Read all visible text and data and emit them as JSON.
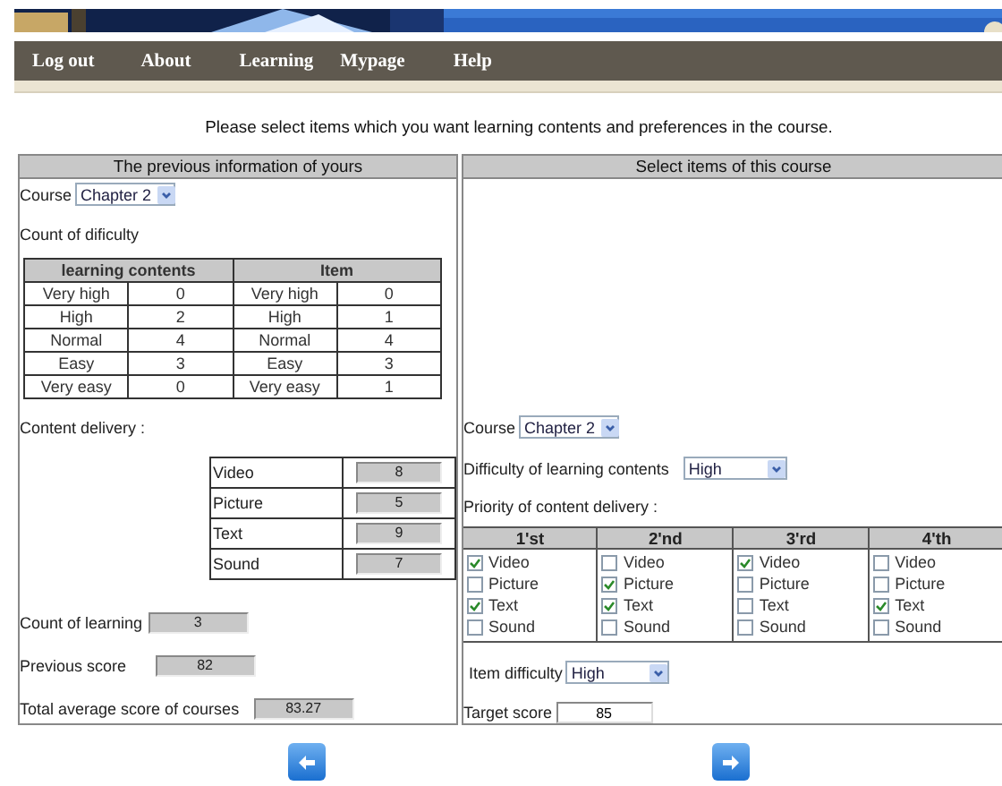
{
  "nav": {
    "items": [
      "Log out",
      "About",
      "Learning",
      "Mypage",
      "Help"
    ]
  },
  "instruction": "Please select items which you want learning contents and preferences in the course.",
  "previous": {
    "title": "The previous information of yours",
    "course": {
      "label": "Course",
      "value": "Chapter 2"
    },
    "difficulty_title": "Count of dificulty",
    "difficulty_table": {
      "groups": [
        "learning contents",
        "Item"
      ],
      "rows": [
        [
          "Very high",
          "0",
          "Very high",
          "0"
        ],
        [
          "High",
          "2",
          "High",
          "1"
        ],
        [
          "Normal",
          "4",
          "Normal",
          "4"
        ],
        [
          "Easy",
          "3",
          "Easy",
          "3"
        ],
        [
          "Very easy",
          "0",
          "Very easy",
          "1"
        ]
      ]
    },
    "delivery_title": "Content delivery :",
    "delivery": [
      {
        "name": "Video",
        "value": "8"
      },
      {
        "name": "Picture",
        "value": "5"
      },
      {
        "name": "Text",
        "value": "9"
      },
      {
        "name": "Sound",
        "value": "7"
      }
    ],
    "fields": [
      {
        "label": "Count of learning",
        "value": "3"
      },
      {
        "label": "Previous score",
        "value": "82"
      },
      {
        "label": "Total average score of courses",
        "value": "83.27"
      }
    ]
  },
  "select": {
    "title": "Select items of this course",
    "course": {
      "label": "Course",
      "value": "Chapter 2"
    },
    "content_difficulty": {
      "label": "Difficulty of learning contents",
      "value": "High"
    },
    "priority_title": "Priority of content delivery :",
    "priority": [
      {
        "heading": "1'st",
        "options": [
          {
            "label": "Video",
            "checked": true
          },
          {
            "label": "Picture",
            "checked": false
          },
          {
            "label": "Text",
            "checked": true
          },
          {
            "label": "Sound",
            "checked": false
          }
        ]
      },
      {
        "heading": "2'nd",
        "options": [
          {
            "label": "Video",
            "checked": false
          },
          {
            "label": "Picture",
            "checked": true
          },
          {
            "label": "Text",
            "checked": true
          },
          {
            "label": "Sound",
            "checked": false
          }
        ]
      },
      {
        "heading": "3'rd",
        "options": [
          {
            "label": "Video",
            "checked": true
          },
          {
            "label": "Picture",
            "checked": false
          },
          {
            "label": "Text",
            "checked": false
          },
          {
            "label": "Sound",
            "checked": false
          }
        ]
      },
      {
        "heading": "4'th",
        "options": [
          {
            "label": "Video",
            "checked": false
          },
          {
            "label": "Picture",
            "checked": false
          },
          {
            "label": "Text",
            "checked": true
          },
          {
            "label": "Sound",
            "checked": false
          }
        ]
      }
    ],
    "item_difficulty": {
      "label": "Item difficulty",
      "value": "High"
    },
    "target_score": {
      "label": "Target score",
      "value": "85"
    }
  },
  "buttons": [
    {
      "kind": "back"
    },
    {
      "kind": "next"
    }
  ]
}
